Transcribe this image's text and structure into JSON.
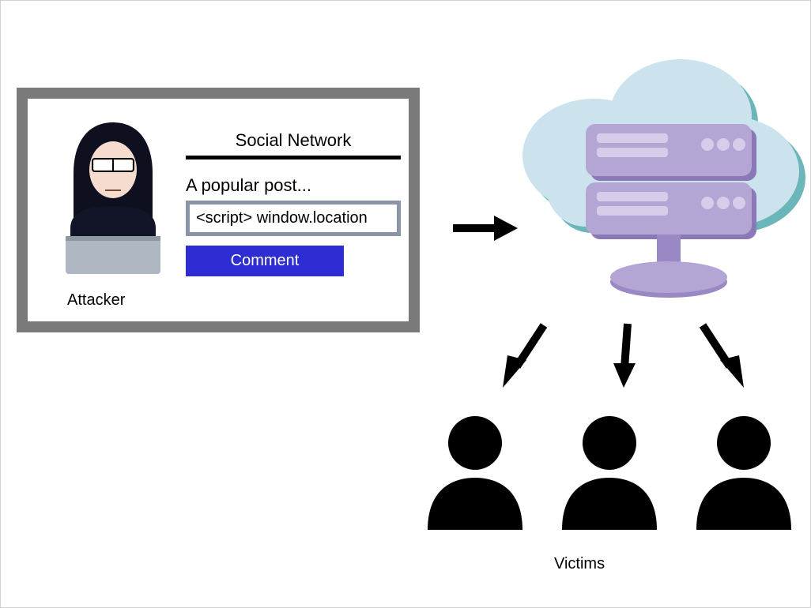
{
  "attacker_label": "Attacker",
  "victims_label": "Victims",
  "social": {
    "title": "Social Network",
    "post_label": "A popular post...",
    "script_text": "<script> window.location",
    "comment_label": "Comment"
  },
  "colors": {
    "frame_border": "#7a7a7a",
    "button_bg": "#2d2dd3",
    "input_border": "#8b93a6",
    "cloud_fill": "#cce3ee",
    "cloud_shadow": "#6bb6b8",
    "server_body": "#b3a5d4",
    "server_dark": "#8a78b8",
    "server_slot": "#d6cdea"
  }
}
